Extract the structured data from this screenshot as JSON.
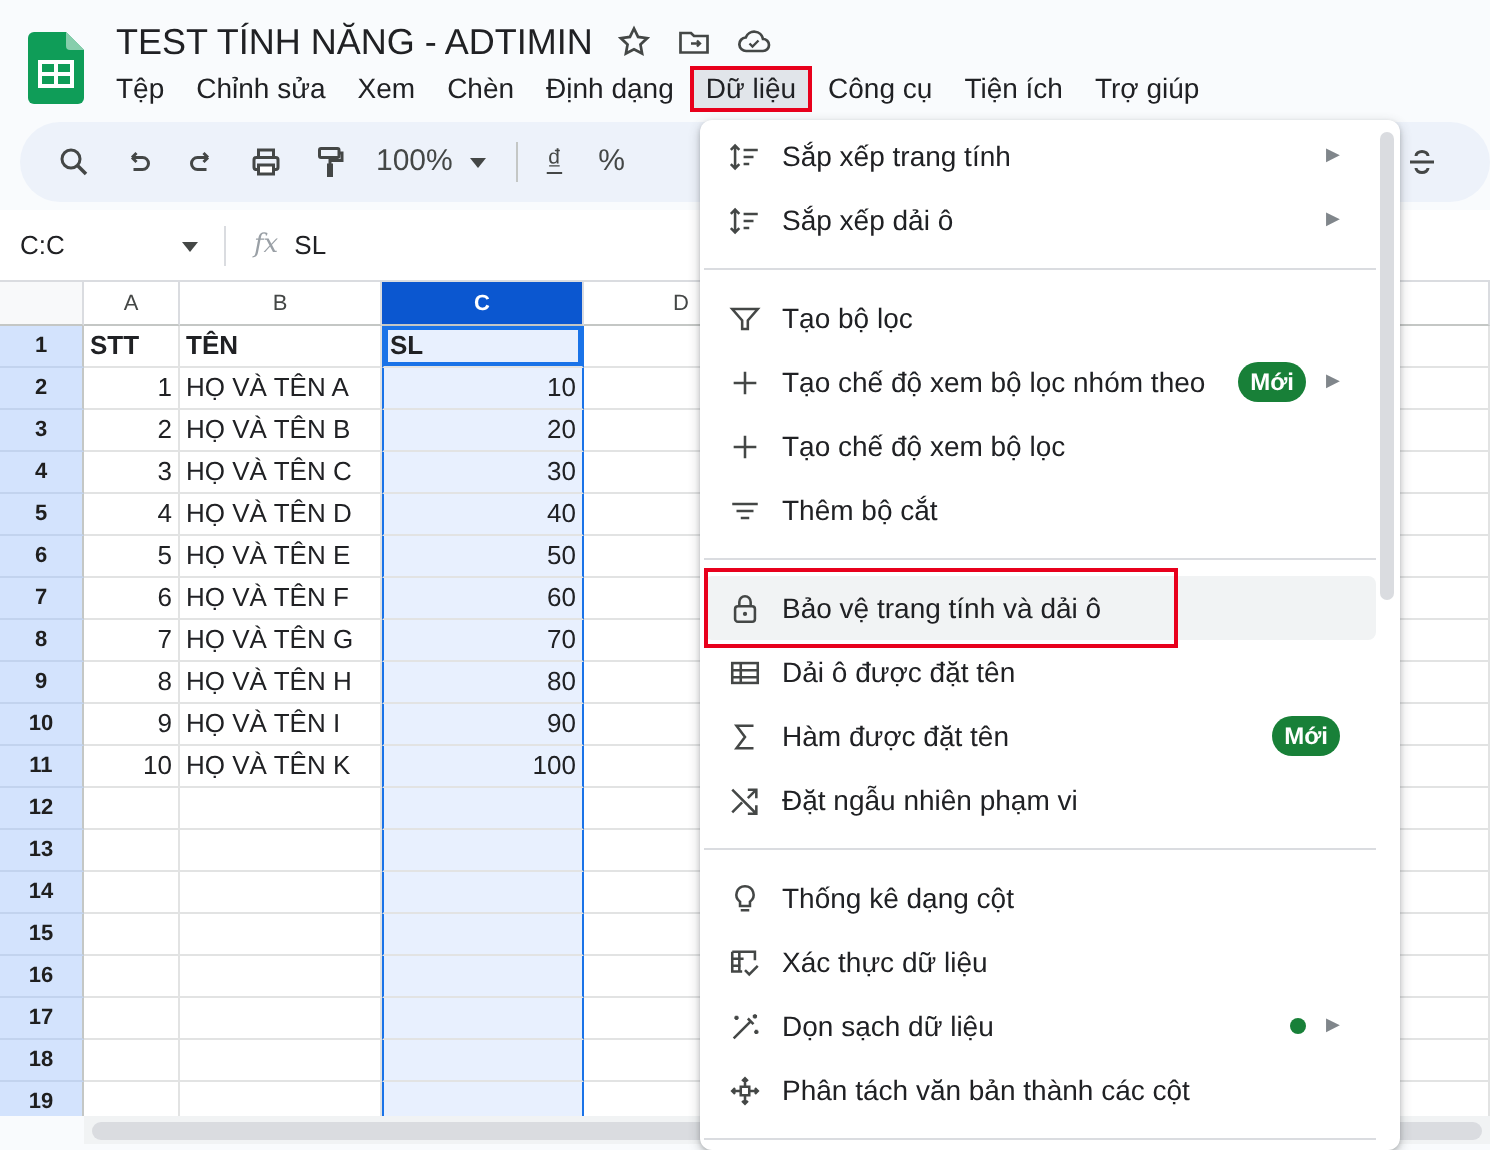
{
  "document": {
    "title": "TEST TÍNH NĂNG - ADTIMIN"
  },
  "menubar": [
    {
      "label": "Tệp",
      "selected": false,
      "annotated": false
    },
    {
      "label": "Chỉnh sửa",
      "selected": false,
      "annotated": false
    },
    {
      "label": "Xem",
      "selected": false,
      "annotated": false
    },
    {
      "label": "Chèn",
      "selected": false,
      "annotated": false
    },
    {
      "label": "Định dạng",
      "selected": false,
      "annotated": false
    },
    {
      "label": "Dữ liệu",
      "selected": true,
      "annotated": true
    },
    {
      "label": "Công cụ",
      "selected": false,
      "annotated": false
    },
    {
      "label": "Tiện ích",
      "selected": false,
      "annotated": false
    },
    {
      "label": "Trợ giúp",
      "selected": false,
      "annotated": false
    }
  ],
  "toolbar": {
    "zoom": "100%",
    "currency": "₫",
    "percent": "%"
  },
  "formula_bar": {
    "name_box": "C:C",
    "fx": "fx",
    "content": "SL"
  },
  "sheet": {
    "columns": [
      {
        "label": "A",
        "selected": false,
        "numeric": true
      },
      {
        "label": "B",
        "selected": false,
        "numeric": false
      },
      {
        "label": "C",
        "selected": true,
        "numeric": true
      },
      {
        "label": "D",
        "selected": false
      }
    ],
    "rows": [
      {
        "number": "1",
        "kind": "header",
        "cells": [
          "STT",
          "TÊN",
          "SL"
        ]
      },
      {
        "number": "2",
        "kind": "data",
        "cells": [
          "1",
          "HỌ VÀ TÊN A",
          "10"
        ]
      },
      {
        "number": "3",
        "kind": "data",
        "cells": [
          "2",
          "HỌ VÀ TÊN B",
          "20"
        ]
      },
      {
        "number": "4",
        "kind": "data",
        "cells": [
          "3",
          "HỌ VÀ TÊN C",
          "30"
        ]
      },
      {
        "number": "5",
        "kind": "data",
        "cells": [
          "4",
          "HỌ VÀ TÊN D",
          "40"
        ]
      },
      {
        "number": "6",
        "kind": "data",
        "cells": [
          "5",
          "HỌ VÀ TÊN E",
          "50"
        ]
      },
      {
        "number": "7",
        "kind": "data",
        "cells": [
          "6",
          "HỌ VÀ TÊN F",
          "60"
        ]
      },
      {
        "number": "8",
        "kind": "data",
        "cells": [
          "7",
          "HỌ VÀ TÊN G",
          "70"
        ]
      },
      {
        "number": "9",
        "kind": "data",
        "cells": [
          "8",
          "HỌ VÀ TÊN H",
          "80"
        ]
      },
      {
        "number": "10",
        "kind": "data",
        "cells": [
          "9",
          "HỌ VÀ TÊN I",
          "90"
        ]
      },
      {
        "number": "11",
        "kind": "data",
        "cells": [
          "10",
          "HỌ VÀ TÊN K",
          "100"
        ]
      },
      {
        "number": "12",
        "kind": "data"
      },
      {
        "number": "13",
        "kind": "data"
      },
      {
        "number": "14",
        "kind": "data"
      },
      {
        "number": "15",
        "kind": "data"
      },
      {
        "number": "16",
        "kind": "data"
      },
      {
        "number": "17",
        "kind": "data"
      },
      {
        "number": "18",
        "kind": "data"
      },
      {
        "number": "19",
        "kind": "data"
      }
    ]
  },
  "data_menu": {
    "groups": [
      [
        {
          "label": "Sắp xếp trang tính",
          "highlighted": false,
          "annotated": false,
          "arrow": "▶"
        },
        {
          "label": "Sắp xếp dải ô",
          "highlighted": false,
          "annotated": false,
          "arrow": "▶"
        }
      ],
      [
        {
          "label": "Tạo bộ lọc",
          "highlighted": false,
          "annotated": false
        },
        {
          "label": "Tạo chế độ xem bộ lọc nhóm theo",
          "highlighted": false,
          "annotated": false,
          "badge": "Mới",
          "arrow": "▶"
        },
        {
          "label": "Tạo chế độ xem bộ lọc",
          "highlighted": false,
          "annotated": false
        },
        {
          "label": "Thêm bộ cắt",
          "highlighted": false,
          "annotated": false
        }
      ],
      [
        {
          "label": "Bảo vệ trang tính và dải ô",
          "highlighted": true,
          "annotated": true
        },
        {
          "label": "Dải ô được đặt tên",
          "highlighted": false,
          "annotated": false
        },
        {
          "label": "Hàm được đặt tên",
          "highlighted": false,
          "annotated": false,
          "badge": "Mới"
        },
        {
          "label": "Đặt ngẫu nhiên phạm vi",
          "highlighted": false,
          "annotated": false
        }
      ],
      [
        {
          "label": "Thống kê dạng cột",
          "highlighted": false,
          "annotated": false
        },
        {
          "label": "Xác thực dữ liệu",
          "highlighted": false,
          "annotated": false
        },
        {
          "label": "Dọn sạch dữ liệu",
          "highlighted": false,
          "annotated": false,
          "color": "#188038",
          "arrow": "▶"
        },
        {
          "label": "Phân tách văn bản thành các cột",
          "highlighted": false,
          "annotated": false
        }
      ]
    ]
  }
}
